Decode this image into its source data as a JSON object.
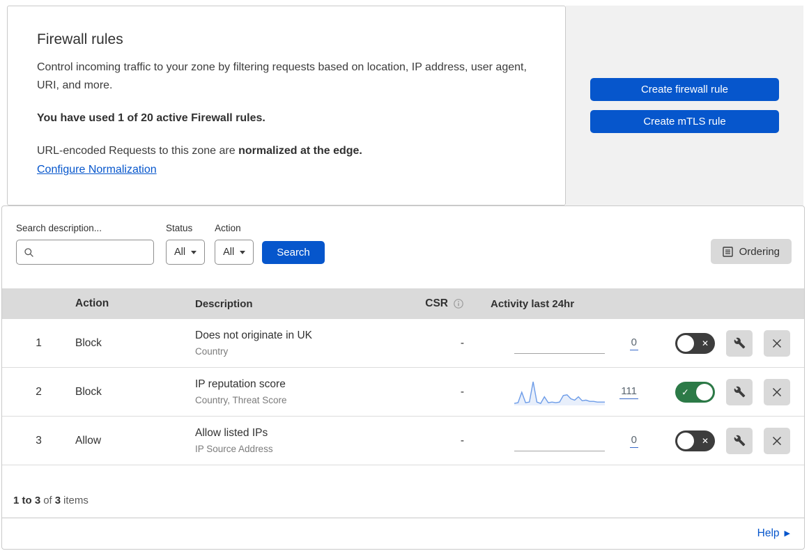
{
  "header": {
    "title": "Firewall rules",
    "description": "Control incoming traffic to your zone by filtering requests based on location, IP address, user agent, URI, and more.",
    "usage": "You have used 1 of 20 active Firewall rules.",
    "normalization_prefix": "URL-encoded Requests to this zone are ",
    "normalization_bold": "normalized at the edge.",
    "normalization_link": "Configure Normalization"
  },
  "actions_panel": {
    "create_firewall_rule": "Create firewall rule",
    "create_mtls_rule": "Create mTLS rule"
  },
  "filters": {
    "search_label": "Search description...",
    "status_label": "Status",
    "status_value": "All",
    "action_label": "Action",
    "action_value": "All",
    "search_button": "Search",
    "ordering_button": "Ordering"
  },
  "table": {
    "headers": {
      "action": "Action",
      "description": "Description",
      "csr": "CSR",
      "activity": "Activity last 24hr"
    },
    "rows": [
      {
        "num": "1",
        "action": "Block",
        "description": "Does not originate in UK",
        "criteria": "Country",
        "csr": "-",
        "activity_count": "0",
        "enabled": false
      },
      {
        "num": "2",
        "action": "Block",
        "description": "IP reputation score",
        "criteria": "Country, Threat Score",
        "csr": "-",
        "activity_count": "111",
        "enabled": true,
        "sparkline": [
          1,
          2,
          18,
          2,
          3,
          34,
          3,
          1,
          11,
          2,
          3,
          2,
          3,
          13,
          14,
          8,
          6,
          11,
          5,
          6,
          4,
          4,
          3,
          3,
          3
        ]
      },
      {
        "num": "3",
        "action": "Allow",
        "description": "Allow listed IPs",
        "criteria": "IP Source Address",
        "csr": "-",
        "activity_count": "0",
        "enabled": false
      }
    ],
    "footer": {
      "range": "1 to 3",
      "of": "of",
      "total": "3",
      "items": "items"
    }
  },
  "help": {
    "label": "Help"
  },
  "colors": {
    "accent_blue": "#0656cc",
    "toggle_on_green": "#2c7a47",
    "toggle_off_gray": "#3d3d3d",
    "sparkline_blue": "#6d9ce8",
    "table_header_gray": "#dadada"
  }
}
